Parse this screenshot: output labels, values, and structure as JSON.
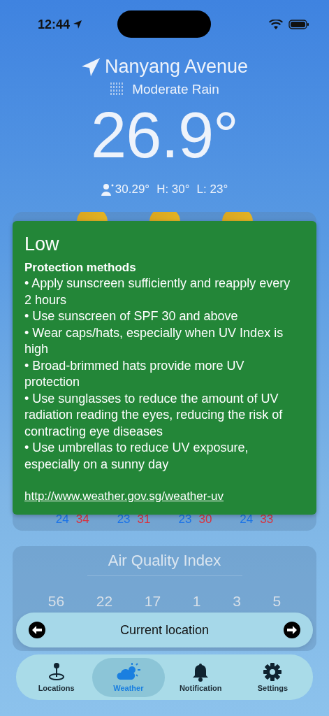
{
  "status_bar": {
    "time": "12:44"
  },
  "location": {
    "name": "Nanyang Avenue",
    "condition": "Moderate Rain",
    "temperature": "26.9°",
    "feels_like": "30.29°",
    "high": "H: 30°",
    "low": "L: 23°"
  },
  "forecast": {
    "days": [
      {
        "low": "24",
        "high": "34"
      },
      {
        "low": "23",
        "high": "31"
      },
      {
        "low": "23",
        "high": "30"
      },
      {
        "low": "24",
        "high": "33"
      }
    ]
  },
  "uv_popup": {
    "level": "Low",
    "heading": "Protection methods",
    "tips": [
      "• Apply sunscreen sufficiently and reapply every 2 hours",
      "• Use sunscreen of SPF 30 and above",
      "• Wear caps/hats, especially when UV Index is high",
      "• Broad-brimmed hats provide more UV protection",
      "• Use sunglasses to reduce the amount of UV radiation reading the eyes, reducing the risk of contracting eye diseases",
      "• Use umbrellas to reduce UV exposure, especially on a sunny day"
    ],
    "link": "http://www.weather.gov.sg/weather-uv"
  },
  "air_quality": {
    "title": "Air Quality Index",
    "values": [
      "56",
      "22",
      "17",
      "1",
      "3",
      "5"
    ]
  },
  "location_switcher": {
    "label": "Current location"
  },
  "tabs": [
    {
      "label": "Locations",
      "kind": "pin",
      "selected": false
    },
    {
      "label": "Weather",
      "kind": "cloud-sun",
      "selected": true
    },
    {
      "label": "Notification",
      "kind": "bell",
      "selected": false
    },
    {
      "label": "Settings",
      "kind": "gear",
      "selected": false
    }
  ]
}
